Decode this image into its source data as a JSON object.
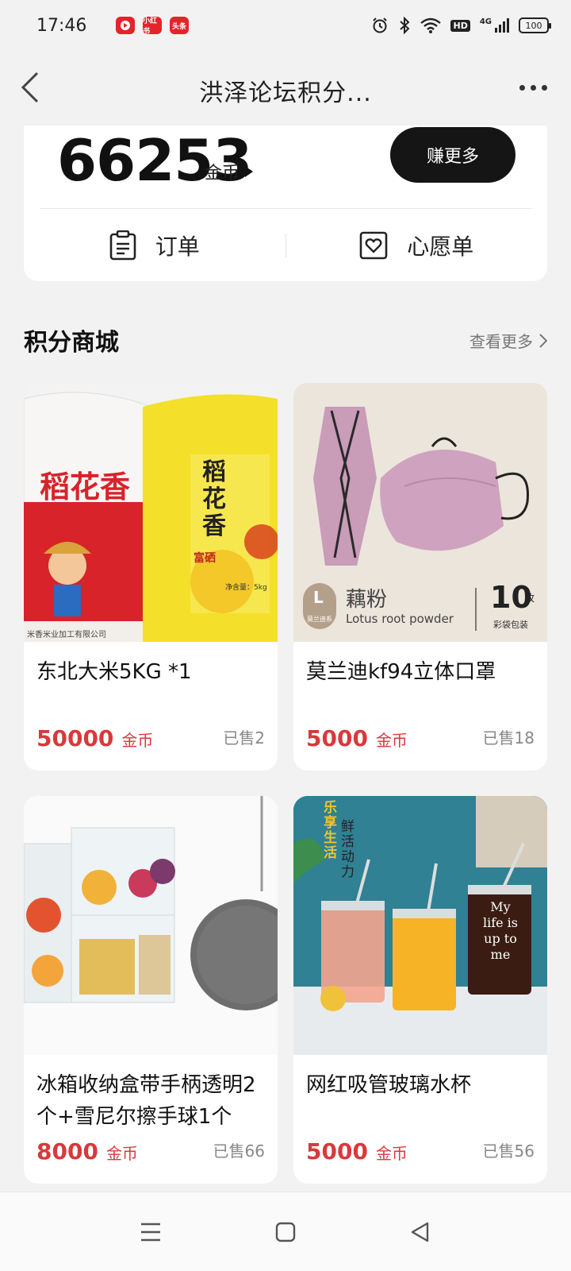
{
  "status_bar": {
    "time": "17:46",
    "apps": [
      "",
      "小红书",
      "头条"
    ],
    "hd": "HD",
    "net": "4G",
    "battery": "100"
  },
  "nav": {
    "title": "洪泽论坛积分..."
  },
  "coin_card": {
    "amount": "66253",
    "unit": "金币",
    "earn_button": "赚更多",
    "order_label": "订单",
    "wishlist_label": "心愿单"
  },
  "section": {
    "title": "积分商城",
    "more": "查看更多"
  },
  "products": [
    {
      "name": "东北大米5KG *1",
      "price": "50000",
      "unit": "金币",
      "sold": "已售2",
      "image_text": {
        "brand1": "稻花香",
        "bag_bottom": "米香米业加工有限公司",
        "bag2": "稻花香",
        "bag2_sub": "富硒",
        "weight": "净含量：5kg"
      }
    },
    {
      "name": "莫兰迪kf94立体口罩",
      "price": "5000",
      "unit": "金币",
      "sold": "已售18",
      "image_text": {
        "badge_letter": "L",
        "badge_sub": "莫兰迪系",
        "color_name": "藕粉",
        "color_en": "Lotus root powder",
        "count": "10",
        "count_unit": "枚",
        "pack": "彩袋包装"
      }
    },
    {
      "name": "冰箱收纳盒带手柄透明2个+雪尼尔擦手球1个",
      "price": "8000",
      "unit": "金币",
      "sold": "已售66"
    },
    {
      "name": "网红吸管玻璃水杯",
      "price": "5000",
      "unit": "金币",
      "sold": "已售56",
      "image_text": {
        "vertical1": "乐享生活",
        "vertical2": "鲜活动力",
        "cup_text": "My life is up to me"
      }
    }
  ],
  "colors": {
    "price": "#d8393b",
    "earn_button_bg": "#151515"
  }
}
